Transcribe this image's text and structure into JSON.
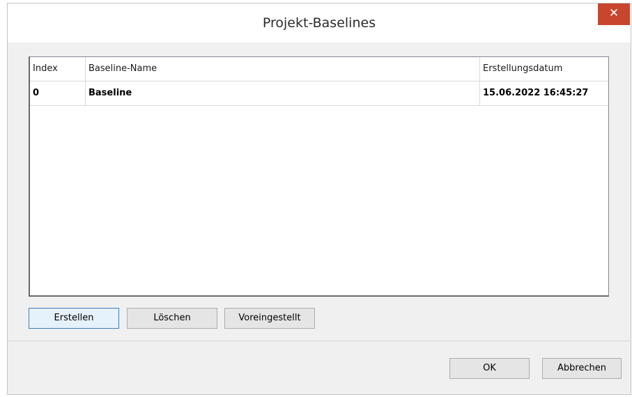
{
  "window": {
    "title": "Projekt-Baselines",
    "close_glyph": "✕"
  },
  "table": {
    "columns": [
      "Index",
      "Baseline-Name",
      "Erstellungsdatum"
    ],
    "rows": [
      {
        "index": "0",
        "name": "Baseline",
        "date": "15.06.2022 16:45:27"
      }
    ]
  },
  "actions": {
    "create": "Erstellen",
    "delete": "Löschen",
    "default": "Voreingestellt"
  },
  "footer": {
    "ok": "OK",
    "cancel": "Abbrechen"
  }
}
